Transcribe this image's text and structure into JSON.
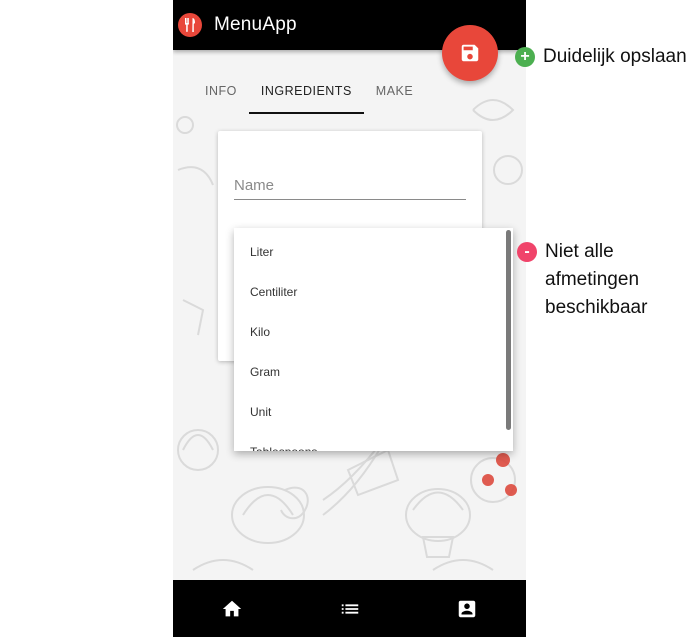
{
  "app": {
    "title": "MenuApp"
  },
  "tabs": [
    {
      "label": "INFO",
      "active": false
    },
    {
      "label": "INGREDIENTS",
      "active": true
    },
    {
      "label": "MAKE",
      "active": false
    }
  ],
  "form": {
    "name_placeholder": "Name",
    "name_value": ""
  },
  "unit_dropdown": {
    "options": [
      "Liter",
      "Centiliter",
      "Kilo",
      "Gram",
      "Unit",
      "Tablespoons"
    ]
  },
  "fab": {
    "icon": "save-icon"
  },
  "bottom_nav": [
    {
      "icon": "home-icon"
    },
    {
      "icon": "list-icon"
    },
    {
      "icon": "contact-card-icon"
    }
  ],
  "annotations": {
    "positive": {
      "symbol": "+",
      "color": "#4caf50",
      "text": "Duidelijk opslaan"
    },
    "negative": {
      "symbol": "-",
      "color": "#f0446a",
      "lines": [
        "Niet alle",
        "afmetingen",
        "beschikbaar"
      ]
    }
  },
  "colors": {
    "accent": "#e8473a",
    "bar": "#000000"
  }
}
